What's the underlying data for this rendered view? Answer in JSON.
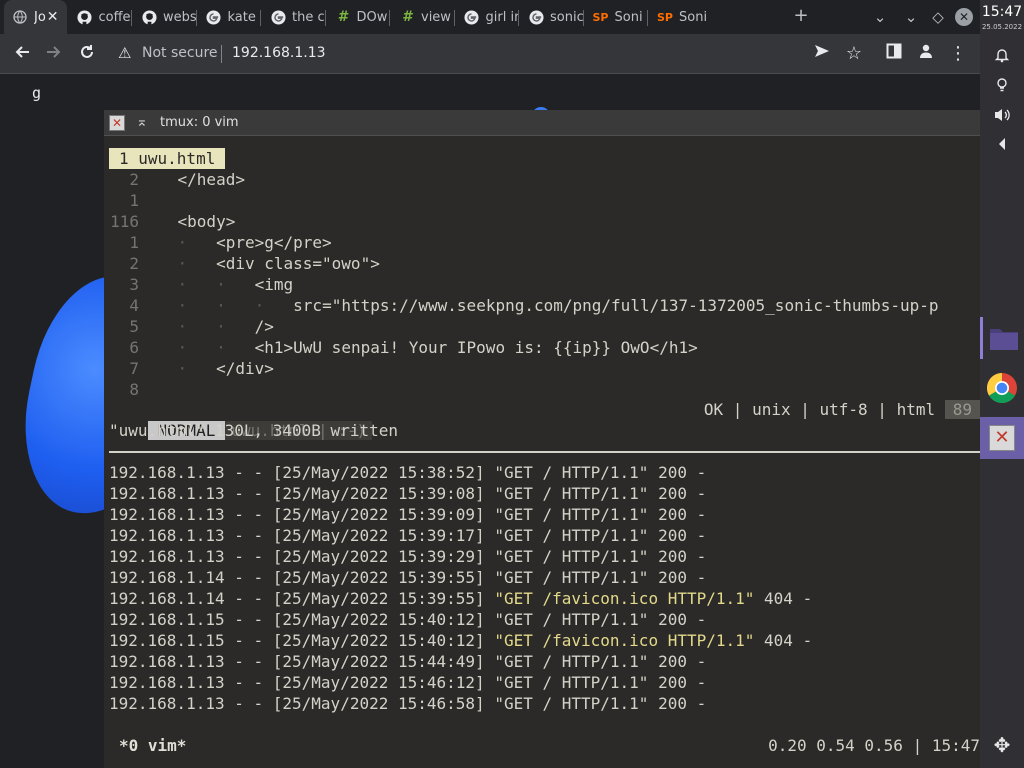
{
  "browser": {
    "tabs": [
      {
        "title": "Jo",
        "icon": "globe-icon",
        "active": true
      },
      {
        "title": "coffe",
        "icon": "github-icon"
      },
      {
        "title": "webs",
        "icon": "github-icon"
      },
      {
        "title": "kate",
        "icon": "google-icon"
      },
      {
        "title": "the c",
        "icon": "google-icon"
      },
      {
        "title": "DOw",
        "icon": "hashtag-icon"
      },
      {
        "title": "view",
        "icon": "hashtag-icon"
      },
      {
        "title": "girl ir",
        "icon": "google-icon"
      },
      {
        "title": "sonic",
        "icon": "google-icon"
      },
      {
        "title": "Soni",
        "icon": "sp-icon"
      },
      {
        "title": "Soni",
        "icon": "sp-icon"
      }
    ],
    "security_label": "Not secure",
    "url": "192.168.1.13"
  },
  "page": {
    "pre_text": "g"
  },
  "terminal": {
    "title": "tmux: 0 vim",
    "vim": {
      "tab_label": "1 uwu.html",
      "lines": [
        {
          "num": "2",
          "text": "    </head>"
        },
        {
          "num": "1",
          "text": ""
        },
        {
          "num": "116",
          "text": "    <body>"
        },
        {
          "num": "1",
          "text": "    ·   <pre>g</pre>"
        },
        {
          "num": "2",
          "text": "    ·   <div class=\"owo\">"
        },
        {
          "num": "3",
          "text": "    ·   ·   <img"
        },
        {
          "num": "4",
          "text": "    ·   ·   ·   src=\"https://www.seekpng.com/png/full/137-1372005_sonic-thumbs-up-p"
        },
        {
          "num": "5",
          "text": "    ·   ·   />"
        },
        {
          "num": "6",
          "text": "    ·   ·   <h1>UwU senpai! Your IPowo is: {{ip}} OwO</h1>"
        },
        {
          "num": "7",
          "text": "    ·   </div>"
        },
        {
          "num": "8",
          "text": ""
        }
      ],
      "status_mode": "NORMAL",
      "status_file": "uwu.html | :-)",
      "status_right": "OK | unix | utf-8 | html ",
      "status_pct": "89",
      "message": "\"uwu.html\" 130L, 3400B written"
    },
    "log": [
      {
        "pre": "192.168.1.13 - - [25/May/2022 15:38:52] ",
        "req": "\"GET / HTTP/1.1\"",
        "post": " 200 -",
        "warn": false
      },
      {
        "pre": "192.168.1.13 - - [25/May/2022 15:39:08] ",
        "req": "\"GET / HTTP/1.1\"",
        "post": " 200 -",
        "warn": false
      },
      {
        "pre": "192.168.1.13 - - [25/May/2022 15:39:09] ",
        "req": "\"GET / HTTP/1.1\"",
        "post": " 200 -",
        "warn": false
      },
      {
        "pre": "192.168.1.13 - - [25/May/2022 15:39:17] ",
        "req": "\"GET / HTTP/1.1\"",
        "post": " 200 -",
        "warn": false
      },
      {
        "pre": "192.168.1.13 - - [25/May/2022 15:39:29] ",
        "req": "\"GET / HTTP/1.1\"",
        "post": " 200 -",
        "warn": false
      },
      {
        "pre": "192.168.1.14 - - [25/May/2022 15:39:55] ",
        "req": "\"GET / HTTP/1.1\"",
        "post": " 200 -",
        "warn": false
      },
      {
        "pre": "192.168.1.14 - - [25/May/2022 15:39:55] ",
        "req": "\"GET /favicon.ico HTTP/1.1\"",
        "post": " 404 -",
        "warn": true
      },
      {
        "pre": "192.168.1.15 - - [25/May/2022 15:40:12] ",
        "req": "\"GET / HTTP/1.1\"",
        "post": " 200 -",
        "warn": false
      },
      {
        "pre": "192.168.1.15 - - [25/May/2022 15:40:12] ",
        "req": "\"GET /favicon.ico HTTP/1.1\"",
        "post": " 404 -",
        "warn": true
      },
      {
        "pre": "192.168.1.13 - - [25/May/2022 15:44:49] ",
        "req": "\"GET / HTTP/1.1\"",
        "post": " 200 -",
        "warn": false
      },
      {
        "pre": "192.168.1.13 - - [25/May/2022 15:46:12] ",
        "req": "\"GET / HTTP/1.1\"",
        "post": " 200 -",
        "warn": false
      },
      {
        "pre": "192.168.1.13 - - [25/May/2022 15:46:58] ",
        "req": "\"GET / HTTP/1.1\"",
        "post": " 200 -",
        "warn": false
      }
    ],
    "tmux_window": "*0 vim*",
    "tmux_load": "0.20 0.54 0.56 | 15:47"
  },
  "system": {
    "time": "15:47",
    "date": "25.05.2022"
  },
  "colors": {
    "accent": "#6b5fa8",
    "log_highlight": "#e2d98a"
  }
}
